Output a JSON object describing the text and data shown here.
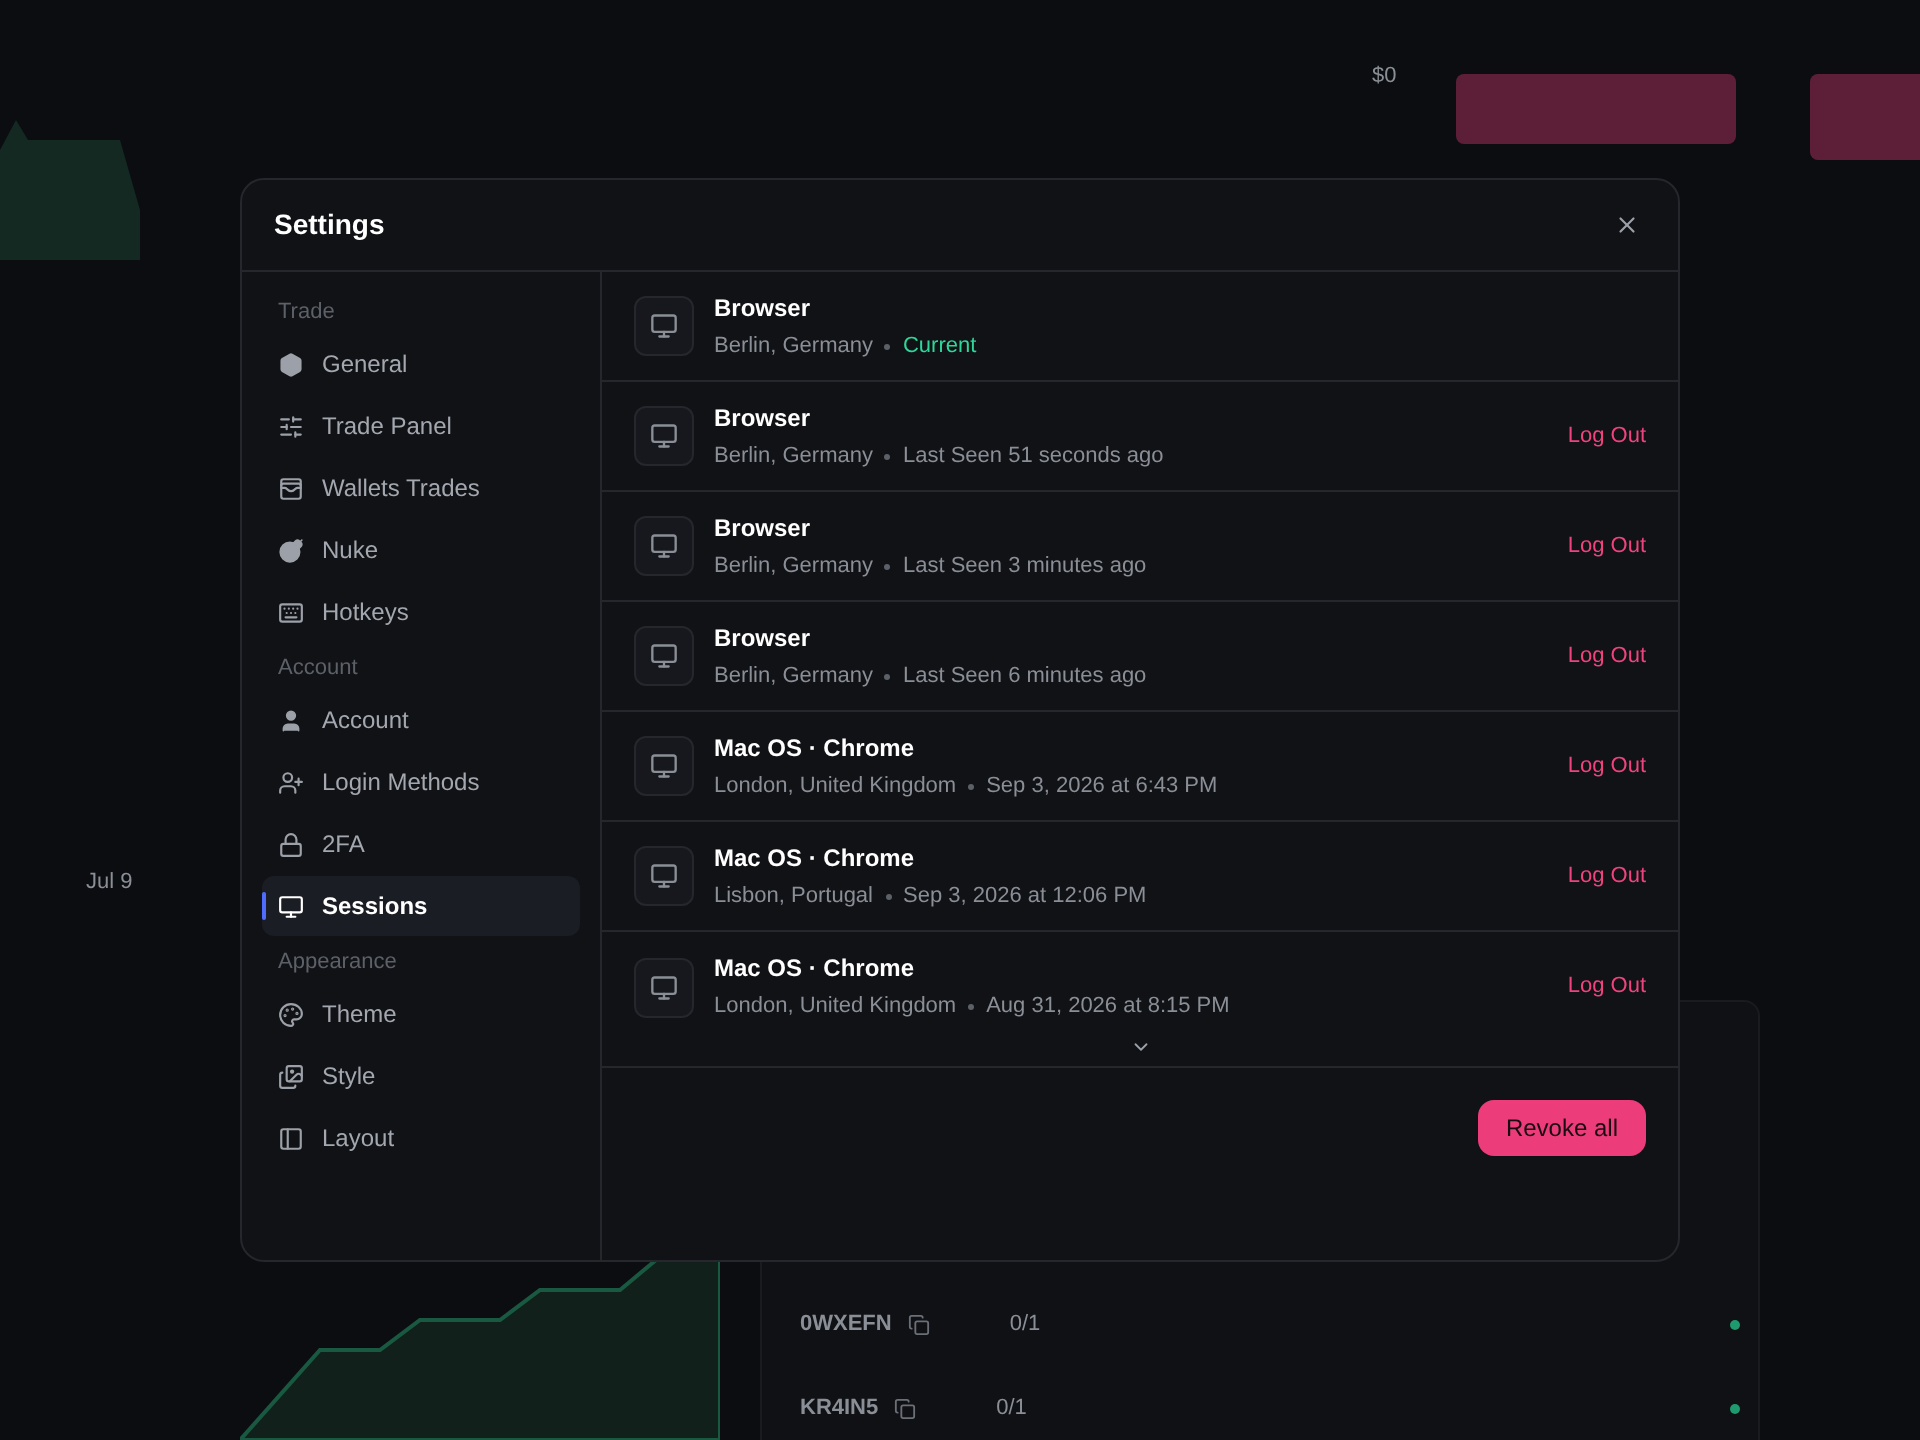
{
  "backdrop": {
    "price_label": "$0",
    "date_label": "Jul 9",
    "rows": [
      {
        "code": "0WXEFN",
        "count": "0/1"
      },
      {
        "code": "KR4IN5",
        "count": "0/1"
      }
    ]
  },
  "dialog": {
    "title": "Settings",
    "sidebar": [
      {
        "heading": "Trade",
        "items": [
          {
            "label": "General",
            "selected": false
          },
          {
            "label": "Trade Panel",
            "selected": false
          },
          {
            "label": "Wallets Trades",
            "selected": false
          },
          {
            "label": "Nuke",
            "selected": false
          },
          {
            "label": "Hotkeys",
            "selected": false
          }
        ]
      },
      {
        "heading": "Account",
        "items": [
          {
            "label": "Account",
            "selected": false
          },
          {
            "label": "Login Methods",
            "selected": false
          },
          {
            "label": "2FA",
            "selected": false
          },
          {
            "label": "Sessions",
            "selected": true
          }
        ]
      },
      {
        "heading": "Appearance",
        "items": [
          {
            "label": "Theme",
            "selected": false
          },
          {
            "label": "Style",
            "selected": false
          },
          {
            "label": "Layout",
            "selected": false
          }
        ]
      }
    ],
    "sessions": [
      {
        "name": "Browser",
        "location": "Berlin, Germany",
        "status": "Current",
        "current": true
      },
      {
        "name": "Browser",
        "location": "Berlin, Germany",
        "status": "Last Seen 51 seconds ago",
        "current": false,
        "action": "Log Out"
      },
      {
        "name": "Browser",
        "location": "Berlin, Germany",
        "status": "Last Seen 3 minutes ago",
        "current": false,
        "action": "Log Out"
      },
      {
        "name": "Browser",
        "location": "Berlin, Germany",
        "status": "Last Seen 6 minutes ago",
        "current": false,
        "action": "Log Out"
      },
      {
        "name": "Mac OS · Chrome",
        "location": "London, United Kingdom",
        "status": "Sep 3, 2026 at 6:43 PM",
        "current": false,
        "action": "Log Out"
      },
      {
        "name": "Mac OS · Chrome",
        "location": "Lisbon, Portugal",
        "status": "Sep 3, 2026 at 12:06 PM",
        "current": false,
        "action": "Log Out"
      },
      {
        "name": "Mac OS · Chrome",
        "location": "London, United Kingdom",
        "status": "Aug 31, 2026 at 8:15 PM",
        "current": false,
        "action": "Log Out"
      }
    ],
    "revoke_button": "Revoke all"
  }
}
